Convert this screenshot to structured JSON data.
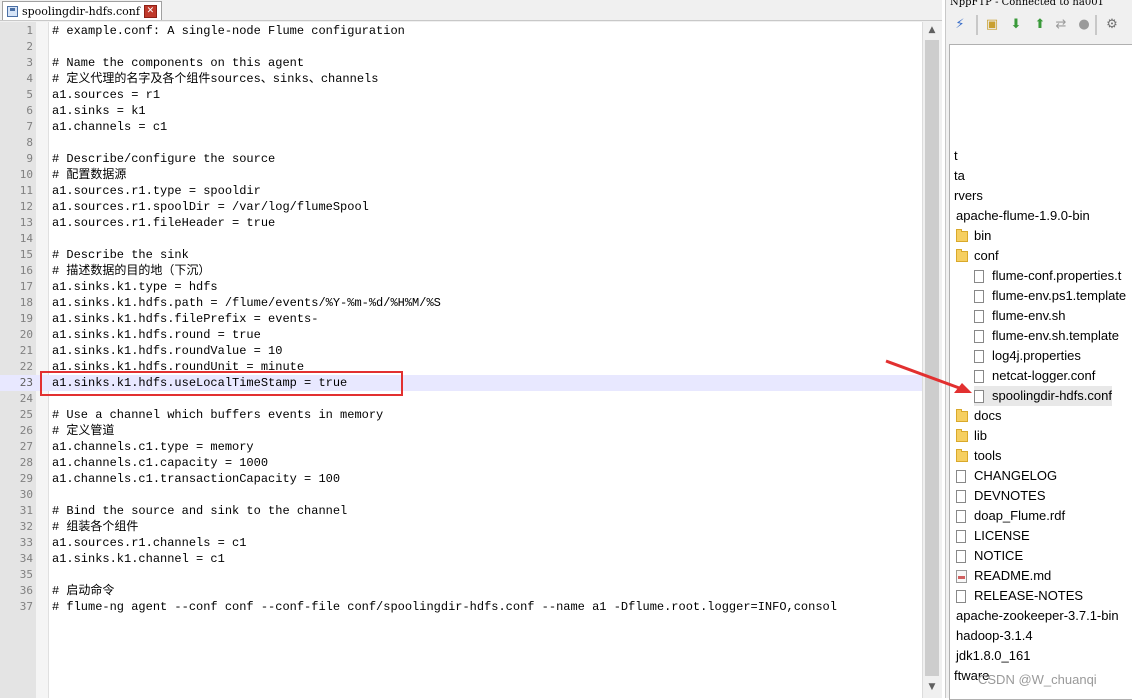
{
  "editor": {
    "tab": {
      "label": "spoolingdir-hdfs.conf",
      "close_glyph": "✕"
    },
    "current_line": 23,
    "lines": [
      "# example.conf: A single-node Flume configuration",
      "",
      "# Name the components on this agent",
      "# 定义代理的名字及各个组件sources、sinks、channels",
      "a1.sources = r1",
      "a1.sinks = k1",
      "a1.channels = c1",
      "",
      "# Describe/configure the source",
      "# 配置数据源",
      "a1.sources.r1.type = spooldir",
      "a1.sources.r1.spoolDir = /var/log/flumeSpool",
      "a1.sources.r1.fileHeader = true",
      "",
      "# Describe the sink",
      "# 描述数据的目的地（下沉）",
      "a1.sinks.k1.type = hdfs",
      "a1.sinks.k1.hdfs.path = /flume/events/%Y-%m-%d/%H%M/%S",
      "a1.sinks.k1.hdfs.filePrefix = events-",
      "a1.sinks.k1.hdfs.round = true",
      "a1.sinks.k1.hdfs.roundValue = 10",
      "a1.sinks.k1.hdfs.roundUnit = minute",
      "a1.sinks.k1.hdfs.useLocalTimeStamp = true",
      "",
      "# Use a channel which buffers events in memory",
      "# 定义管道",
      "a1.channels.c1.type = memory",
      "a1.channels.c1.capacity = 1000",
      "a1.channels.c1.transactionCapacity = 100",
      "",
      "# Bind the source and sink to the channel",
      "# 组装各个组件",
      "a1.sources.r1.channels = c1",
      "a1.sinks.k1.channel = c1",
      "",
      "# 启动命令",
      "# flume-ng agent --conf conf --conf-file conf/spoolingdir-hdfs.conf --name a1 -Dflume.root.logger=INFO,consol"
    ]
  },
  "ftp": {
    "title": "NppFTP - Connected to ha001",
    "toolbar": [
      "connect-icon",
      "open-folder-icon",
      "download-icon",
      "upload-icon",
      "refresh-icon",
      "abort-icon",
      "settings-icon"
    ],
    "tree": [
      {
        "label": "t",
        "type": "text",
        "indent": 0
      },
      {
        "label": "ta",
        "type": "text",
        "indent": 0
      },
      {
        "label": "rvers",
        "type": "text",
        "indent": 0
      },
      {
        "label": "apache-flume-1.9.0-bin",
        "type": "text",
        "indent": 1
      },
      {
        "label": "bin",
        "type": "folder",
        "indent": 2
      },
      {
        "label": "conf",
        "type": "folder",
        "indent": 2
      },
      {
        "label": "flume-conf.properties.t",
        "type": "file",
        "indent": 3
      },
      {
        "label": "flume-env.ps1.template",
        "type": "file",
        "indent": 3
      },
      {
        "label": "flume-env.sh",
        "type": "file",
        "indent": 3
      },
      {
        "label": "flume-env.sh.template",
        "type": "file",
        "indent": 3
      },
      {
        "label": "log4j.properties",
        "type": "file",
        "indent": 3
      },
      {
        "label": "netcat-logger.conf",
        "type": "file",
        "indent": 3
      },
      {
        "label": "spoolingdir-hdfs.conf",
        "type": "file",
        "indent": 3,
        "selected": true
      },
      {
        "label": "docs",
        "type": "folder",
        "indent": 2
      },
      {
        "label": "lib",
        "type": "folder",
        "indent": 2
      },
      {
        "label": "tools",
        "type": "folder",
        "indent": 2
      },
      {
        "label": "CHANGELOG",
        "type": "file",
        "indent": 2
      },
      {
        "label": "DEVNOTES",
        "type": "file",
        "indent": 2
      },
      {
        "label": "doap_Flume.rdf",
        "type": "file",
        "indent": 2
      },
      {
        "label": "LICENSE",
        "type": "file",
        "indent": 2
      },
      {
        "label": "NOTICE",
        "type": "file",
        "indent": 2
      },
      {
        "label": "README.md",
        "type": "md",
        "indent": 2
      },
      {
        "label": "RELEASE-NOTES",
        "type": "file",
        "indent": 2
      },
      {
        "label": "apache-zookeeper-3.7.1-bin",
        "type": "text",
        "indent": 1
      },
      {
        "label": "hadoop-3.1.4",
        "type": "text",
        "indent": 1
      },
      {
        "label": "jdk1.8.0_161",
        "type": "text",
        "indent": 1
      },
      {
        "label": "ftware",
        "type": "text",
        "indent": 0
      }
    ]
  },
  "watermark": "CSDN @W_chuanqi",
  "colors": {
    "annotation": "#e23030",
    "current_line": "#e8e8ff",
    "folder": "#f6cf61"
  }
}
